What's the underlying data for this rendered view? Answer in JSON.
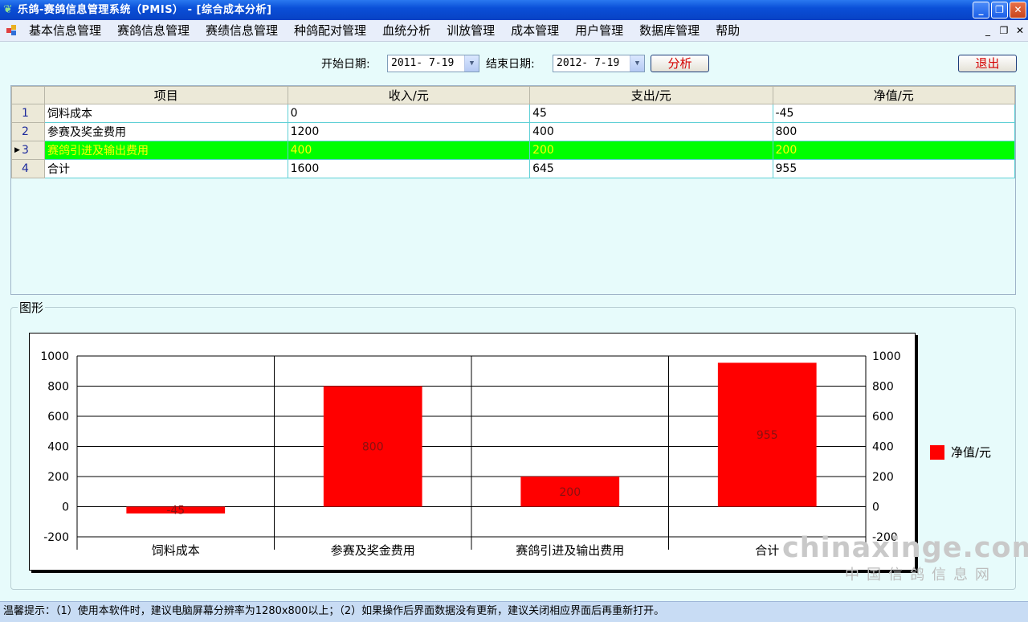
{
  "window": {
    "title": "乐鸽-赛鸽信息管理系统（PMIS） - [综合成本分析]",
    "minimize": "_",
    "restore": "❐",
    "close": "✕"
  },
  "menu": {
    "items": [
      "基本信息管理",
      "赛鸽信息管理",
      "赛绩信息管理",
      "种鸽配对管理",
      "血统分析",
      "训放管理",
      "成本管理",
      "用户管理",
      "数据库管理",
      "帮助"
    ],
    "mdi_minimize": "_",
    "mdi_restore": "❐",
    "mdi_close": "✕"
  },
  "filter": {
    "start_label": "开始日期:",
    "start_value": "2011- 7-19",
    "end_label": "结束日期:",
    "end_value": "2012- 7-19",
    "analyze_button": "分析",
    "exit_button": "退出"
  },
  "grid": {
    "headers": [
      "项目",
      "收入/元",
      "支出/元",
      "净值/元"
    ],
    "rows": [
      {
        "num": "1",
        "item": "饲料成本",
        "income": "0",
        "expense": "45",
        "net": "-45"
      },
      {
        "num": "2",
        "item": "参赛及奖金费用",
        "income": "1200",
        "expense": "400",
        "net": "800"
      },
      {
        "num": "3",
        "item": "赛鸽引进及输出费用",
        "income": "400",
        "expense": "200",
        "net": "200"
      },
      {
        "num": "4",
        "item": "合计",
        "income": "1600",
        "expense": "645",
        "net": "955"
      }
    ],
    "selected_row": 3
  },
  "group": {
    "label": "图形"
  },
  "chart_data": {
    "type": "bar",
    "categories": [
      "饲料成本",
      "参赛及奖金费用",
      "赛鸽引进及输出费用",
      "合计"
    ],
    "series": [
      {
        "name": "净值/元",
        "values": [
          -45,
          800,
          200,
          955
        ],
        "color": "#ff0000"
      }
    ],
    "data_labels": [
      "-45",
      "800",
      "200",
      "955"
    ],
    "ylim": [
      -200,
      1000
    ],
    "yticks": [
      -200,
      0,
      200,
      400,
      600,
      800,
      1000
    ],
    "ytick_labels": [
      "-200",
      "0",
      "200",
      "400",
      "600",
      "800",
      "1000"
    ],
    "secondary_y_axis": true,
    "grid": true,
    "legend": "right"
  },
  "watermark": {
    "line1": "chinaxinge.com",
    "line2": "中国信鸽信息网"
  },
  "status": {
    "text": "温馨提示：（1）使用本软件时，建议电脑屏幕分辨率为1280x800以上；（2）如果操作后界面数据没有更新，建议关闭相应界面后再重新打开。"
  }
}
